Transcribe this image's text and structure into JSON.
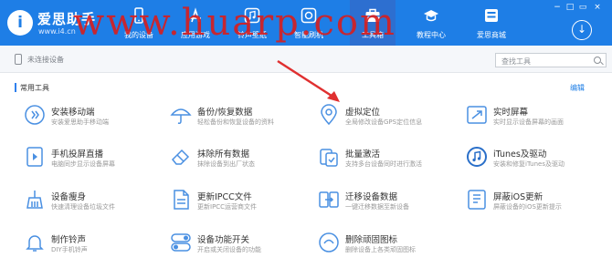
{
  "app": {
    "name": "爱思助手",
    "url": "www.i4.cn"
  },
  "nav": [
    {
      "label": "我的设备",
      "icon": "phone-icon"
    },
    {
      "label": "应用游戏",
      "icon": "app-store-icon"
    },
    {
      "label": "铃声壁纸",
      "icon": "music-icon"
    },
    {
      "label": "智能刷机",
      "icon": "flash-icon"
    },
    {
      "label": "工具箱",
      "icon": "toolbox-icon",
      "active": true
    },
    {
      "label": "教程中心",
      "icon": "graduation-cap-icon"
    },
    {
      "label": "爱思商城",
      "icon": "shop-icon"
    }
  ],
  "device_bar": {
    "status": "未连接设备",
    "search_placeholder": "查找工具"
  },
  "section": {
    "title": "常用工具",
    "edit": "编辑"
  },
  "tools": [
    {
      "name": "安装移动端",
      "desc": "安装爱思助手移动端",
      "icon": "install-mobile-icon"
    },
    {
      "name": "备份/恢复数据",
      "desc": "轻松备份和恢复设备的资料",
      "icon": "umbrella-icon"
    },
    {
      "name": "虚拟定位",
      "desc": "全局修改设备GPS定位信息",
      "icon": "location-pin-icon"
    },
    {
      "name": "实时屏幕",
      "desc": "实时显示设备屏幕的画面",
      "icon": "screen-mirror-icon"
    },
    {
      "name": "手机投屏直播",
      "desc": "电脑同步显示设备屏幕",
      "icon": "play-screen-icon"
    },
    {
      "name": "抹除所有数据",
      "desc": "抹除设备到出厂状态",
      "icon": "eraser-icon"
    },
    {
      "name": "批量激活",
      "desc": "支持多台设备同时进行激活",
      "icon": "batch-activate-icon"
    },
    {
      "name": "iTunes及驱动",
      "desc": "安装和修复iTunes及驱动",
      "icon": "itunes-icon"
    },
    {
      "name": "设备瘦身",
      "desc": "快速清理设备垃圾文件",
      "icon": "broom-icon"
    },
    {
      "name": "更新IPCC文件",
      "desc": "更新IPCC运营商文件",
      "icon": "ipcc-file-icon"
    },
    {
      "name": "迁移设备数据",
      "desc": "一键迁移数据至新设备",
      "icon": "migrate-icon"
    },
    {
      "name": "屏蔽iOS更新",
      "desc": "屏蔽设备的iOS更新提示",
      "icon": "block-update-icon"
    },
    {
      "name": "制作铃声",
      "desc": "DIY手机铃声",
      "icon": "bell-icon"
    },
    {
      "name": "设备功能开关",
      "desc": "开启或关闭设备的功能",
      "icon": "toggle-icon"
    },
    {
      "name": "删除顽固图标",
      "desc": "删除设备上各类顽固图标",
      "icon": "delete-icon-icon"
    }
  ],
  "watermark": "www.huarp.com",
  "colors": {
    "header": "#1e7ee6",
    "accent": "#2f80ed",
    "icon_blue": "#4a90e2",
    "annotation": "#e03030"
  }
}
